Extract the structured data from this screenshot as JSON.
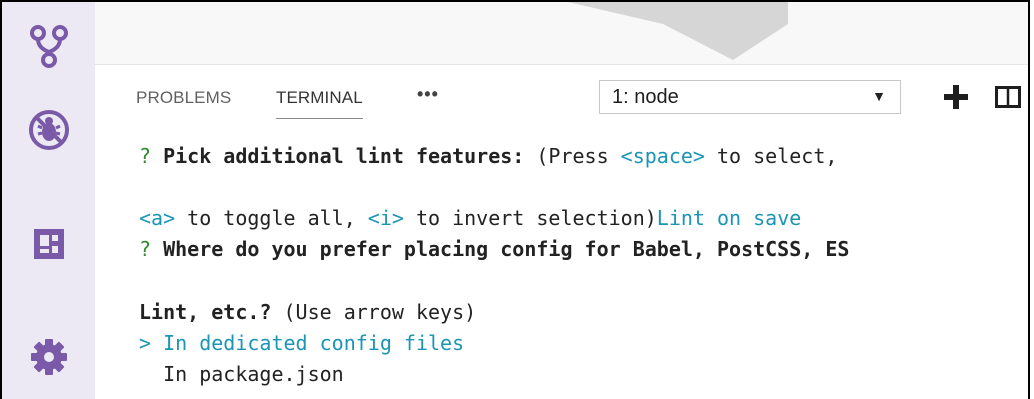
{
  "panel": {
    "tabs": [
      {
        "label": "PROBLEMS",
        "active": false
      },
      {
        "label": "TERMINAL",
        "active": true
      }
    ],
    "more_label": "•••",
    "terminal_select": {
      "value": "1: node",
      "caret": "▼"
    }
  },
  "icons": {
    "activity_bar": [
      "source-control-icon",
      "debug-icon",
      "extensions-icon",
      "settings-gear-icon"
    ],
    "panel_actions": [
      "new-terminal-plus-icon",
      "split-terminal-icon"
    ]
  },
  "colors": {
    "activity_bar_bg": "#ece9f5",
    "activity_icon": "#7a5aa8",
    "prompt_green": "#2e8b2e",
    "hint_cyan": "#1a95b4"
  },
  "terminal": {
    "line1": {
      "q": "?",
      "bold": "Pick additional lint features:",
      "plain": "(Press",
      "key": "<space>",
      "rest": "to select,"
    },
    "line2": {
      "key_a": "<a>",
      "mid": "to toggle all,",
      "key_i": "<i>",
      "end": "to invert selection)",
      "answer": "Lint on save"
    },
    "line3": {
      "q": "?",
      "bold": "Where do you prefer placing config for Babel, PostCSS, ES"
    },
    "line4": {
      "bold": "Lint, etc.?",
      "plain": "(Use arrow keys)"
    },
    "line5": {
      "text": "> In dedicated config files"
    },
    "line6": {
      "text": "  In package.json"
    }
  }
}
